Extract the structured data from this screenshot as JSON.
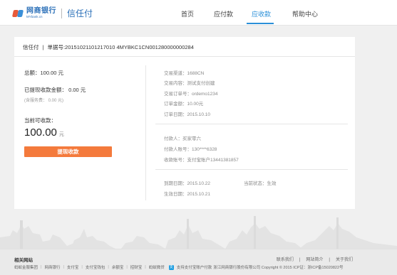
{
  "header": {
    "logo_cn": "网商银行",
    "logo_en": "MYbank.cn",
    "product": "信任付",
    "nav": [
      {
        "label": "首页"
      },
      {
        "label": "应付款"
      },
      {
        "label": "应收款"
      },
      {
        "label": "帮助中心"
      }
    ]
  },
  "order": {
    "product": "信任付",
    "separator": "|",
    "order_no": "单据号:20151021101217010 4MYBKC1CN001280000000284"
  },
  "summary": {
    "total": "总额：100.00  元",
    "withdrawn": "已提现收款金额：  0.00    元",
    "fee_note": "(含服务费：  0.00  元)",
    "receivable_label": "当前可收款：",
    "receivable_amount": "100.00",
    "receivable_unit": "元",
    "pay_button": "提现收款"
  },
  "details": {
    "trade_channel": "交易渠道：1688CN",
    "trade_content": "交易内容：测试支付创建",
    "trade_order_no": "交易订单号：ordemo1234",
    "order_amount": "订单金额：10.00元",
    "order_date": "订单日期：2015.10.10",
    "payer": "付款人：买家零六",
    "payer_account": "付款人账号：130****6328",
    "receive_account": "收款账号：支付宝账户13441381857",
    "due_date": "到期日期：2015.10.22",
    "status": "当前状态：生效",
    "effective_date": "生效日期：2015.10.21"
  },
  "footer": {
    "title": "相关网站",
    "right_links": [
      "联系我们",
      "|",
      "网站简介",
      "|",
      "关于我们"
    ],
    "links": [
      "蚂蚁金服集团",
      "网商银行",
      "支付宝",
      "支付宝钱包",
      "余额宝",
      "招财宝",
      "蚂蚁微贷"
    ],
    "alipay_text": "支持支付宝账户付款",
    "copyright": "浙江网商银行股份有限公司 Copyright © 2015 ICP证：浙ICP备15020822号"
  }
}
